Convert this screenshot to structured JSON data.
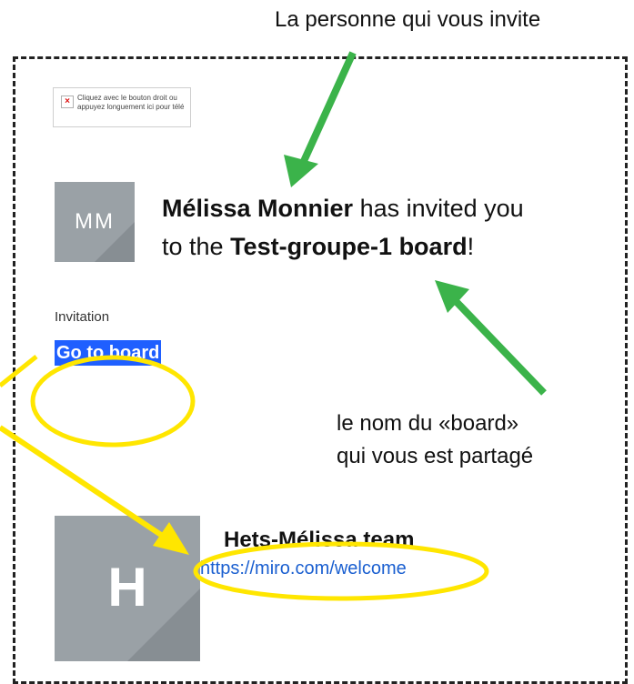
{
  "annotations": {
    "inviter_caption": "La personne qui vous invite",
    "board_caption_line1": "le nom du «board»",
    "board_caption_line2": "qui vous est partagé"
  },
  "email": {
    "broken_image_text": "Cliquez avec le bouton droit ou appuyez longuement ici pour télé",
    "inviter_avatar_initials": "MM",
    "inviter_name": "Mélissa Monnier",
    "invite_text_1": " has invited you",
    "invite_text_2": "to the ",
    "board_name": "Test-groupe-1 board",
    "invite_text_end": "!",
    "invitation_label": "Invitation",
    "go_to_board_label": "Go to board",
    "team_avatar_initial": "H",
    "team_name": "Hets-Mélissa team",
    "team_link": "https://miro.com/welcome"
  },
  "colors": {
    "arrow_green": "#3bb34a",
    "highlight_yellow": "#ffe600",
    "link_blue": "#1a5fd0"
  }
}
